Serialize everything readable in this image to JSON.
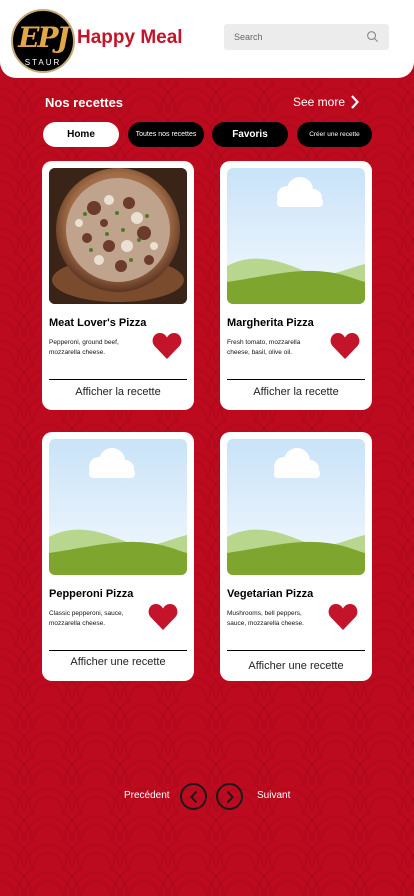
{
  "header": {
    "logo_mark": "EPJ",
    "logo_subtext": "STAUR",
    "brand_name": "Happy Meal",
    "search_placeholder": "Search"
  },
  "section": {
    "title": "Nos recettes",
    "see_more_label": "See more"
  },
  "tabs": [
    {
      "label": "Home",
      "active": true
    },
    {
      "label": "Toutes nos recettes",
      "active": false
    },
    {
      "label": "Favoris",
      "active": false
    },
    {
      "label": "Créer une recette",
      "active": false
    }
  ],
  "recipes": [
    {
      "name": "Meat Lover's Pizza",
      "description": "Pepperoni, ground beef, mozzarella cheese.",
      "link_label": "Afficher la recette",
      "image": "pizza-photo"
    },
    {
      "name": "Margherita Pizza",
      "description": "Fresh tomato, mozzarella cheese, basil, olive oil.",
      "link_label": "Afficher la recette",
      "image": "placeholder-landscape"
    },
    {
      "name": "Pepperoni Pizza",
      "description": "Classic pepperoni, sauce, mozzarella cheese.",
      "link_label": "Afficher une recette",
      "image": "placeholder-landscape"
    },
    {
      "name": "Vegetarian Pizza",
      "description": "Mushrooms, bell peppers, sauce, mozzarella cheese.",
      "link_label": "Afficher une recette",
      "image": "placeholder-landscape"
    }
  ],
  "pagination": {
    "prev_label": "Precédent",
    "next_label": "Suivant"
  },
  "colors": {
    "background": "#bd0a1e",
    "brand": "#c3142b",
    "heart": "#c3142b"
  },
  "icons": {
    "search": "search-icon",
    "see_more": "chevron-right-icon",
    "favorite": "heart-icon",
    "prev": "chevron-left-icon",
    "next": "chevron-right-icon"
  }
}
